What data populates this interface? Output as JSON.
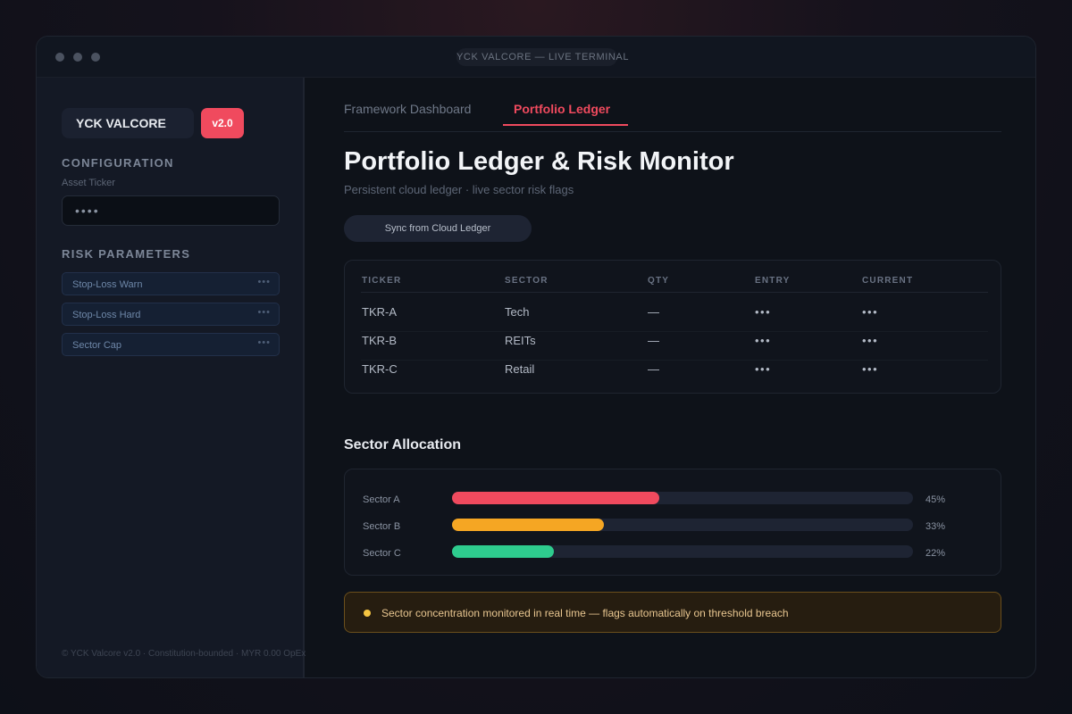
{
  "window": {
    "title": "YCK VALCORE — LIVE TERMINAL"
  },
  "sidebar": {
    "brand": "YCK VALCORE",
    "version": "v2.0",
    "configuration_title": "CONFIGURATION",
    "asset_ticker_label": "Asset Ticker",
    "asset_ticker_value": "••••",
    "risk_parameters_title": "RISK PARAMETERS",
    "params": [
      {
        "label": "Stop-Loss Warn",
        "value": "•••"
      },
      {
        "label": "Stop-Loss Hard",
        "value": "•••"
      },
      {
        "label": "Sector Cap",
        "value": "•••"
      }
    ],
    "footer": "© YCK Valcore v2.0 · Constitution-bounded · MYR 0.00 OpEx"
  },
  "tabs": [
    {
      "label": "Framework Dashboard",
      "active": false
    },
    {
      "label": "Portfolio Ledger",
      "active": true
    }
  ],
  "main": {
    "title": "Portfolio Ledger & Risk Monitor",
    "subtitle": "Persistent cloud ledger · live sector risk flags",
    "sync_button": "Sync from Cloud Ledger"
  },
  "table": {
    "columns": [
      "TICKER",
      "SECTOR",
      "QTY",
      "ENTRY",
      "CURRENT"
    ],
    "rows": [
      [
        "TKR-A",
        "Tech",
        "—",
        "•••",
        "•••"
      ],
      [
        "TKR-B",
        "REITs",
        "—",
        "•••",
        "•••"
      ],
      [
        "TKR-C",
        "Retail",
        "—",
        "•••",
        "•••"
      ]
    ]
  },
  "allocation": {
    "title": "Sector Allocation",
    "sectors": [
      {
        "label": "Sector A",
        "value": 45,
        "display": "45%",
        "color": "#f04a5e"
      },
      {
        "label": "Sector B",
        "value": 33,
        "display": "33%",
        "color": "#f5a623"
      },
      {
        "label": "Sector C",
        "value": 22,
        "display": "22%",
        "color": "#2ecc8e"
      }
    ]
  },
  "alert": {
    "text": "Sector concentration monitored in real time — flags automatically on threshold breach",
    "color": "#f5c542"
  },
  "colors": {
    "accent": "#f04a5e",
    "background": "#0e1219",
    "sidebar": "#141925"
  }
}
